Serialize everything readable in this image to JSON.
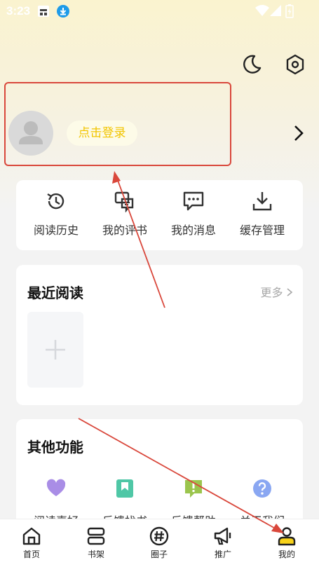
{
  "status_bar": {
    "time": "3:23"
  },
  "header": {
    "login_label": "点击登录"
  },
  "quick_actions": [
    {
      "label": "阅读历史",
      "icon": "history-icon"
    },
    {
      "label": "我的评书",
      "icon": "comments-icon"
    },
    {
      "label": "我的消息",
      "icon": "message-icon"
    },
    {
      "label": "缓存管理",
      "icon": "download-icon"
    }
  ],
  "recent": {
    "title": "最近阅读",
    "more_label": "更多"
  },
  "other": {
    "title": "其他功能",
    "items": [
      {
        "label": "阅读喜好",
        "icon": "heart-icon",
        "color": "#a98de6"
      },
      {
        "label": "反馈找书",
        "icon": "bookmark-icon",
        "color": "#4fc7a6"
      },
      {
        "label": "反馈帮助",
        "icon": "feedback-icon",
        "color": "#9bc54d"
      },
      {
        "label": "关于我们",
        "icon": "question-icon",
        "color": "#8aa7f2"
      }
    ]
  },
  "tabs": [
    {
      "label": "首页",
      "icon": "home-icon"
    },
    {
      "label": "书架",
      "icon": "bookshelf-icon"
    },
    {
      "label": "圈子",
      "icon": "hashtag-icon"
    },
    {
      "label": "推广",
      "icon": "megaphone-icon"
    },
    {
      "label": "我的",
      "icon": "profile-icon"
    }
  ],
  "colors": {
    "accent": "#f2c500",
    "annotation": "#d9473b"
  }
}
